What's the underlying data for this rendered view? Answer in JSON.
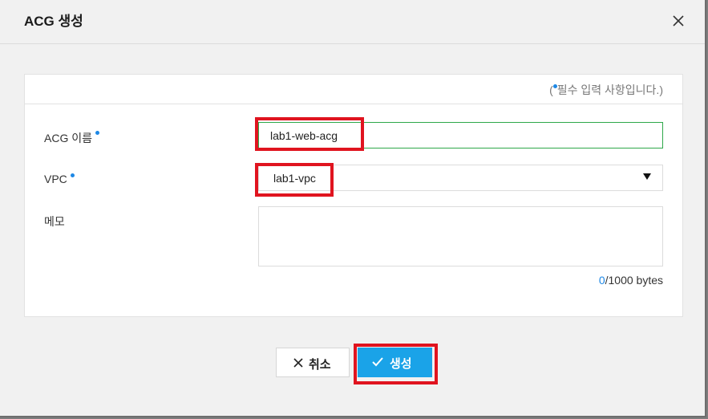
{
  "modal": {
    "title": "ACG 생성",
    "close_icon": "close-icon"
  },
  "form": {
    "required_note_prefix": "(",
    "required_note_text": "필수 입력 사항입니다.)",
    "acg_name": {
      "label": "ACG 이름",
      "required": true,
      "value": "lab1-web-acg"
    },
    "vpc": {
      "label": "VPC",
      "required": true,
      "selected": "lab1-vpc",
      "dropdown_icon": "caret-down-icon"
    },
    "memo": {
      "label": "메모",
      "value": "",
      "byte_count": "0",
      "byte_limit_text": "/1000 bytes"
    }
  },
  "actions": {
    "cancel_label": "취소",
    "cancel_icon": "x-icon",
    "create_label": "생성",
    "create_icon": "check-icon"
  },
  "colors": {
    "accent": "#1aa3e8",
    "required_dot": "#1e88e5",
    "highlight": "#e0141f",
    "input_focus_border": "#2ea84a"
  }
}
